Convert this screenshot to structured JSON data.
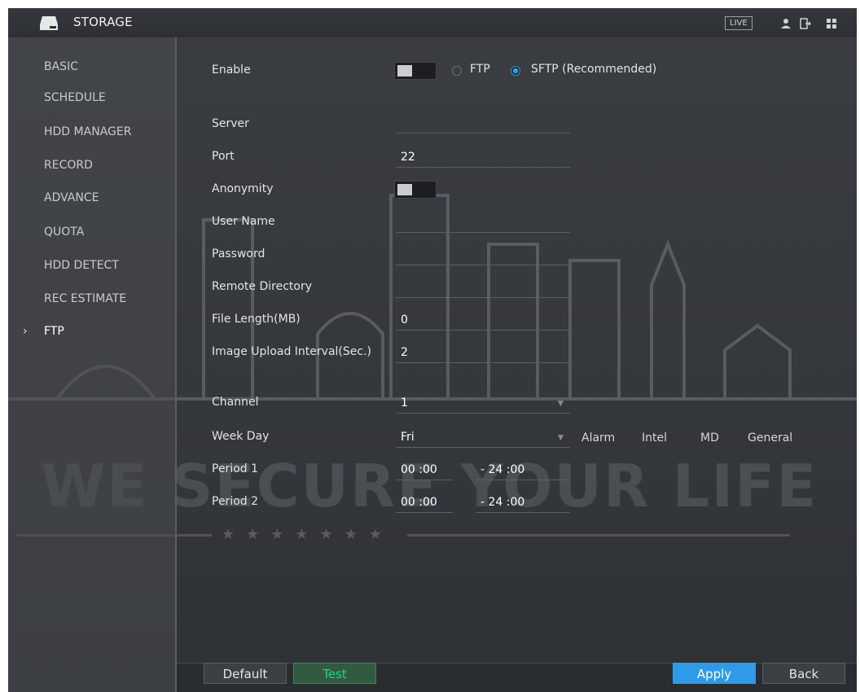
{
  "app": {
    "title": "STORAGE",
    "live_badge": "LIVE"
  },
  "sidebar": {
    "items": [
      {
        "label": "BASIC",
        "active": false
      },
      {
        "label": "SCHEDULE",
        "active": false
      },
      {
        "label": "HDD MANAGER",
        "active": false
      },
      {
        "label": "RECORD",
        "active": false
      },
      {
        "label": "ADVANCE",
        "active": false
      },
      {
        "label": "QUOTA",
        "active": false
      },
      {
        "label": "HDD DETECT",
        "active": false
      },
      {
        "label": "REC ESTIMATE",
        "active": false
      },
      {
        "label": "FTP",
        "active": true
      }
    ],
    "active_marker": "›"
  },
  "form": {
    "enable_label": "Enable",
    "enable_on": false,
    "protocol": {
      "ftp_label": "FTP",
      "sftp_label": "SFTP (Recommended)",
      "selected": "SFTP"
    },
    "server_label": "Server",
    "server_value": "",
    "port_label": "Port",
    "port_value": "22",
    "anonymity_label": "Anonymity",
    "anonymity_on": false,
    "username_label": "User Name",
    "username_value": "",
    "password_label": "Password",
    "password_value": "",
    "remote_dir_label": "Remote Directory",
    "remote_dir_value": "",
    "file_length_label": "File Length(MB)",
    "file_length_value": "0",
    "upload_interval_label": "Image Upload Interval(Sec.)",
    "upload_interval_value": "2",
    "channel_label": "Channel",
    "channel_value": "1",
    "weekday_label": "Week Day",
    "weekday_value": "Fri",
    "columns": [
      "Alarm",
      "Intel",
      "MD",
      "General"
    ],
    "periods": [
      {
        "label": "Period 1",
        "start": "00 :00",
        "end": "- 24 :00"
      },
      {
        "label": "Period 2",
        "start": "00 :00",
        "end": "- 24 :00"
      }
    ]
  },
  "watermark": {
    "text": "WE SECURE YOUR LIFE",
    "stars": "★★★★★★★"
  },
  "footer": {
    "default_label": "Default",
    "test_label": "Test",
    "apply_label": "Apply",
    "back_label": "Back"
  },
  "colors": {
    "accent": "#2f9be8",
    "test_text": "#2bd37b",
    "panel": "#3a3d42"
  }
}
